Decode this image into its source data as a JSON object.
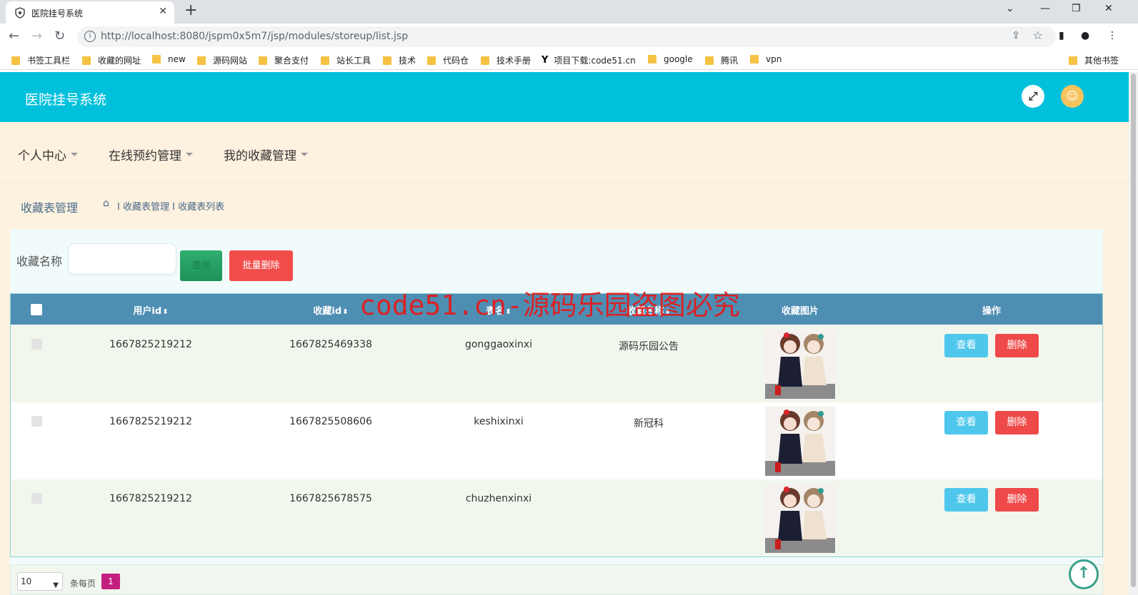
{
  "browser": {
    "tab_title": "医院挂号系统",
    "tab_close": "✕",
    "new_tab": "+",
    "url": "http://localhost:8080/jspm0x5m7/jsp/modules/storeup/list.jsp",
    "bookmarks": [
      "书签工具栏",
      "收藏的网址",
      "new",
      "源码网站",
      "聚合支付",
      "站长工具",
      "技术",
      "代码仓",
      "技术手册",
      "项目下载:code51.cn",
      "google",
      "腾讯",
      "vpn"
    ],
    "other_bookmarks": "其他书签"
  },
  "header": {
    "title": "医院挂号系统"
  },
  "menu": [
    {
      "label": "个人中心"
    },
    {
      "label": "在线预约管理"
    },
    {
      "label": "我的收藏管理"
    }
  ],
  "breadcrumb": {
    "title": "收藏表管理",
    "path": "I 收藏表管理 I 收藏表列表"
  },
  "search": {
    "label": "收藏名称",
    "value": "",
    "search_button": "查询",
    "batch_delete_button": "批量删除"
  },
  "table": {
    "columns": [
      "用户id",
      "收藏id",
      "表名",
      "收藏名称",
      "收藏图片",
      "操作"
    ],
    "rows": [
      {
        "userid": "1667825219212",
        "refid": "1667825469338",
        "tablename": "gonggaoxinxi",
        "name": "源码乐园公告"
      },
      {
        "userid": "1667825219212",
        "refid": "1667825508606",
        "tablename": "keshixinxi",
        "name": "新冠科"
      },
      {
        "userid": "1667825219212",
        "refid": "1667825678575",
        "tablename": "chuzhenxinxi",
        "name": ""
      }
    ],
    "view_label": "查看",
    "delete_label": "删除"
  },
  "pagination": {
    "page_size": "10",
    "page_size_label": "条每页",
    "current_page": "1"
  },
  "watermark": "code51.cn-源码乐园盗图必究",
  "colors": {
    "header": "#00c0dc",
    "table_header": "#4e8eb3",
    "delete": "#ef4a4a",
    "view": "#4fc7ec",
    "page_active": "#c4207f"
  }
}
